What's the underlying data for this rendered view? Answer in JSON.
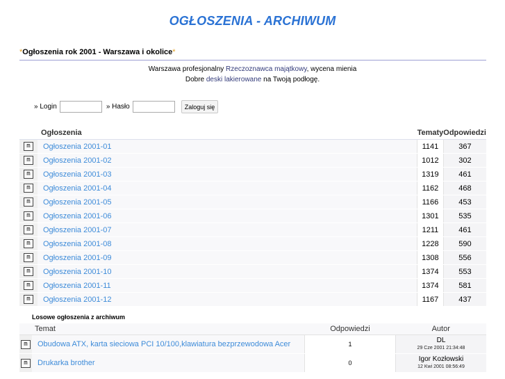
{
  "header": {
    "title": "OGŁOSZENIA - ARCHIWUM",
    "section": "Ogłoszenia rok 2001 - Warszawa i okolice",
    "star": "*"
  },
  "info": {
    "line1_a": "Warszawa profesjonalny ",
    "line1_link": "Rzeczoznawca majątkowy",
    "line1_b": ", wycena mienia",
    "line2_a": "Dobre ",
    "line2_link": "deski lakierowane",
    "line2_b": " na Twoją podłogę."
  },
  "login": {
    "login_label": "» Login",
    "password_label": "» Hasło",
    "login_value": "",
    "password_value": "",
    "submit_label": "Zaloguj się"
  },
  "forums": {
    "headers": {
      "name": "Ogłoszenia",
      "topics": "Tematy",
      "replies": "Odpowiedzi"
    },
    "rows": [
      {
        "name": "Ogłoszenia 2001-01",
        "topics": "1141",
        "replies": "367"
      },
      {
        "name": "Ogłoszenia 2001-02",
        "topics": "1012",
        "replies": "302"
      },
      {
        "name": "Ogłoszenia 2001-03",
        "topics": "1319",
        "replies": "461"
      },
      {
        "name": "Ogłoszenia 2001-04",
        "topics": "1162",
        "replies": "468"
      },
      {
        "name": "Ogłoszenia 2001-05",
        "topics": "1166",
        "replies": "453"
      },
      {
        "name": "Ogłoszenia 2001-06",
        "topics": "1301",
        "replies": "535"
      },
      {
        "name": "Ogłoszenia 2001-07",
        "topics": "1211",
        "replies": "461"
      },
      {
        "name": "Ogłoszenia 2001-08",
        "topics": "1228",
        "replies": "590"
      },
      {
        "name": "Ogłoszenia 2001-09",
        "topics": "1308",
        "replies": "556"
      },
      {
        "name": "Ogłoszenia 2001-10",
        "topics": "1374",
        "replies": "553"
      },
      {
        "name": "Ogłoszenia 2001-11",
        "topics": "1374",
        "replies": "581"
      },
      {
        "name": "Ogłoszenia 2001-12",
        "topics": "1167",
        "replies": "437"
      }
    ]
  },
  "random": {
    "title": "Losowe ogłoszenia z archiwum",
    "headers": {
      "topic": "Temat",
      "replies": "Odpowiedzi",
      "author": "Autor"
    },
    "rows": [
      {
        "topic": "Obudowa ATX, karta sieciowa PCI 10/100,klawiatura bezprzewodowa Acer",
        "replies": "1",
        "author": "DL",
        "date": "29 Cze 2001 21:34:48"
      },
      {
        "topic": "Drukarka brother",
        "replies": "0",
        "author": "Igor Kozłowski",
        "date": "12 Kwi 2001 08:56:49"
      }
    ]
  },
  "icons": {
    "forum": "folder-m-icon",
    "topic": "topic-m-icon"
  },
  "colors": {
    "title": "#2a72d4",
    "link": "#3d8bd9",
    "divider": "#9da0d3",
    "star": "#e0a020"
  }
}
